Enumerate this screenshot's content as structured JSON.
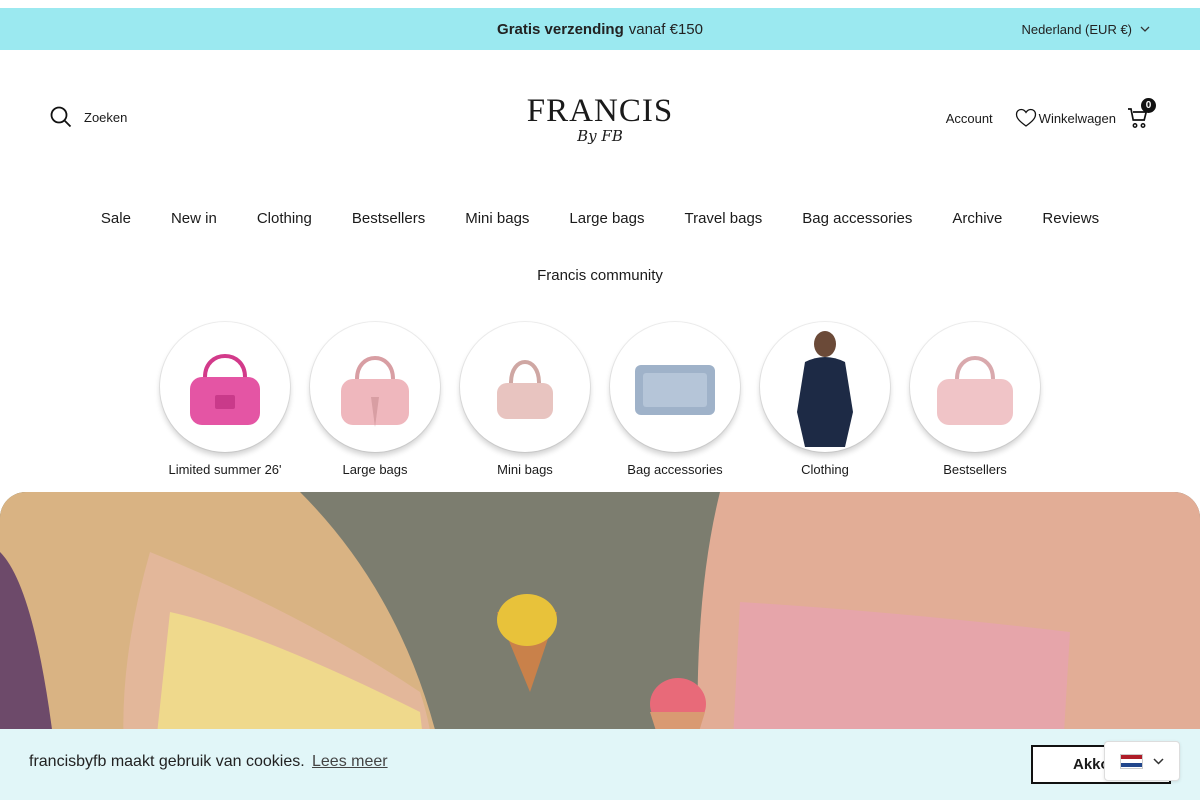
{
  "announcement": {
    "bold": "Gratis verzending",
    "rest": "vanaf €150"
  },
  "country_selector": "Nederland (EUR €)",
  "header": {
    "search_label": "Zoeken",
    "logo_main": "FRANCIS",
    "logo_sub": "By FB",
    "account_label": "Account",
    "wishlist_label": "Winkelwagen",
    "cart_count": "0"
  },
  "nav": {
    "items": [
      "Sale",
      "New in",
      "Clothing",
      "Bestsellers",
      "Mini bags",
      "Large bags",
      "Travel bags",
      "Bag accessories",
      "Archive",
      "Reviews"
    ],
    "second_row": "Francis community"
  },
  "categories": [
    {
      "label": "Limited summer 26'",
      "icon": "pink-handbag"
    },
    {
      "label": "Large bags",
      "icon": "light-pink-handbag"
    },
    {
      "label": "Mini bags",
      "icon": "mini-handbag"
    },
    {
      "label": "Bag accessories",
      "icon": "bag-organizer"
    },
    {
      "label": "Clothing",
      "icon": "model-in-tracksuit"
    },
    {
      "label": "Bestsellers",
      "icon": "bestseller-handbag"
    }
  ],
  "cookie": {
    "text": "francisbyfb maakt gebruik van cookies.",
    "link": "Lees meer",
    "button": "Akkoord"
  },
  "language": {
    "flag": "nl-flag-icon"
  },
  "colors": {
    "announcement_bg": "#9be9f0",
    "cookie_bg": "#e1f6f8"
  }
}
